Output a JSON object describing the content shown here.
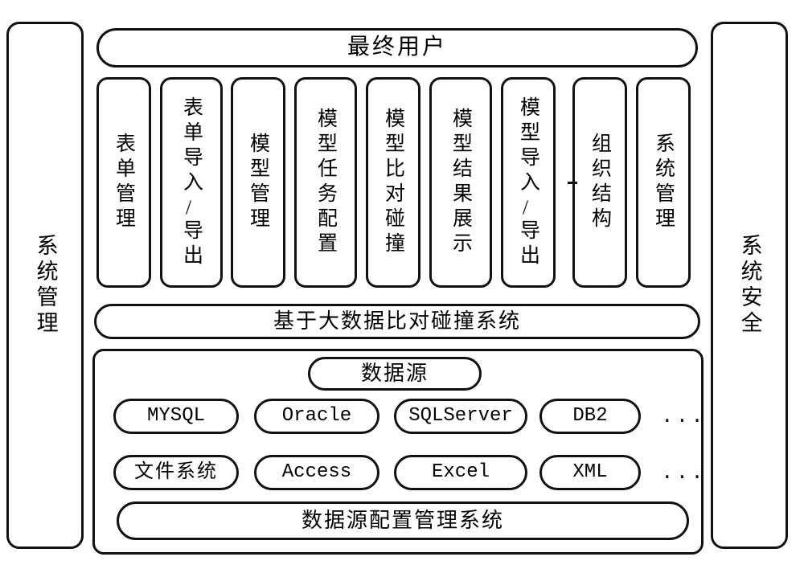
{
  "diagram": {
    "title_top": "最终用户",
    "middle_layer": "基于大数据比对碰撞系统",
    "pillars": {
      "left": "系统管理",
      "right": "系统安全"
    },
    "function_columns": [
      {
        "label": "表单管理"
      },
      {
        "label": "表单导入/导出"
      },
      {
        "label": "模型管理"
      },
      {
        "label": "模型任务配置"
      },
      {
        "label": "模型比对碰撞"
      },
      {
        "label": "模型结果展示"
      },
      {
        "label": "模型导入/导出"
      },
      {
        "label": "组织结构"
      },
      {
        "label": "系统管理"
      }
    ],
    "data_source": {
      "title": "数据源",
      "row1": [
        "MYSQL",
        "Oracle",
        "SQLServer",
        "DB2"
      ],
      "row1_more": "...",
      "row2": [
        "文件系统",
        "Access",
        "Excel",
        "XML"
      ],
      "row2_more": "...",
      "config_bar": "数据源配置管理系统"
    }
  },
  "colors": {
    "stroke": "#111111",
    "background": "#ffffff"
  }
}
